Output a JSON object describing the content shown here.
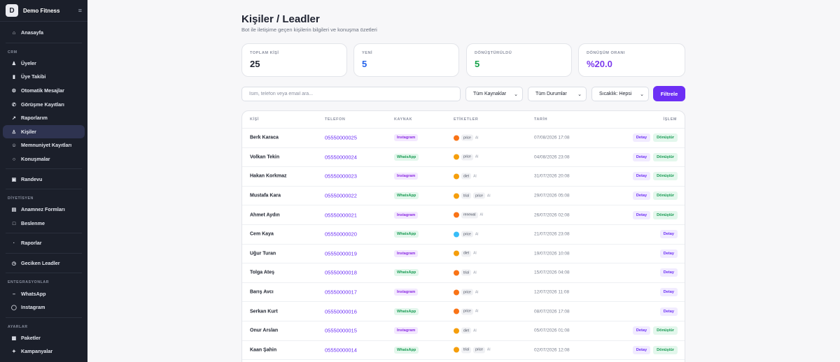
{
  "app": {
    "name": "Demo Fitness",
    "logo_letter": "D"
  },
  "sidebar": {
    "items_top": [
      {
        "label": "Anasayfa",
        "icon": "home-icon"
      }
    ],
    "crm_section": "CRM",
    "crm_items": [
      {
        "label": "Üyeler",
        "icon": "users-icon"
      },
      {
        "label": "Üye Takibi",
        "icon": "bar-chart-icon"
      },
      {
        "label": "Otomatik Mesajlar",
        "icon": "gear-icon"
      },
      {
        "label": "Görüşme Kayıtları",
        "icon": "phone-icon"
      },
      {
        "label": "Raporlarım",
        "icon": "trend-icon"
      },
      {
        "label": "Kişiler",
        "icon": "user-icon",
        "active": true
      },
      {
        "label": "Memnuniyet Kayıtları",
        "icon": "smile-icon"
      },
      {
        "label": "Konuşmalar",
        "icon": "chat-icon"
      }
    ],
    "randevu": {
      "label": "Randevu",
      "icon": "calendar-icon"
    },
    "diyet_section": "DİYETİSYEN",
    "diyet_items": [
      {
        "label": "Anamnez Formları",
        "icon": "document-icon"
      },
      {
        "label": "Beslenme",
        "icon": "message-icon"
      }
    ],
    "raporlar": {
      "label": "Raporlar",
      "icon": "dot-icon"
    },
    "geciken": {
      "label": "Geciken Leadler",
      "icon": "clock-icon"
    },
    "entegrasyon_section": "ENTEGRASYONLAR",
    "entegrasyon_items": [
      {
        "label": "WhatsApp",
        "icon": "dash-icon"
      },
      {
        "label": "Instagram",
        "icon": "instagram-icon"
      }
    ],
    "ayarlar_section": "AYARLAR",
    "ayarlar_items": [
      {
        "label": "Paketler",
        "icon": "package-icon"
      },
      {
        "label": "Kampanyalar",
        "icon": "sparkle-icon"
      }
    ]
  },
  "header": {
    "title": "Kişiler / Leadler",
    "subtitle": "Bot ile iletişime geçen kişilerin bilgileri ve konuşma özetleri"
  },
  "stats": [
    {
      "label": "TOPLAM KİŞİ",
      "value": "25",
      "color": "#1f2430"
    },
    {
      "label": "YENİ",
      "value": "5",
      "color": "#2563eb"
    },
    {
      "label": "DÖNÜŞTÜRÜLDÜ",
      "value": "5",
      "color": "#16a34a"
    },
    {
      "label": "DÖNÜŞÜM ORANI",
      "value": "%20.0",
      "color": "#7c3aed"
    }
  ],
  "filters": {
    "search_placeholder": "İsim, telefon veya email ara...",
    "source": "Tüm Kaynaklar",
    "status": "Tüm Durumlar",
    "temperature": "Sıcaklık: Hepsi",
    "button": "Filtrele"
  },
  "table": {
    "columns": [
      "KİŞİ",
      "TELEFON",
      "KAYNAK",
      "ETİKETLER",
      "TARİH",
      "İŞLEM"
    ],
    "detail_label": "Detay",
    "convert_label": "Dönüştür",
    "rows": [
      {
        "name": "Berk Karaca",
        "phone": "05550000025",
        "source": "Instagram",
        "temp": "hot",
        "tags": [
          "price"
        ],
        "ai": "AI",
        "date": "07/08/2026 17:08",
        "convert": true
      },
      {
        "name": "Volkan Tekin",
        "phone": "05550000024",
        "source": "WhatsApp",
        "temp": "warm",
        "tags": [
          "price"
        ],
        "ai": "AI",
        "date": "04/08/2026 23:08",
        "convert": true
      },
      {
        "name": "Hakan Korkmaz",
        "phone": "05550000023",
        "source": "Instagram",
        "temp": "warm",
        "tags": [
          "diet"
        ],
        "ai": "AI",
        "date": "31/07/2026 20:08",
        "convert": true
      },
      {
        "name": "Mustafa Kara",
        "phone": "05550000022",
        "source": "WhatsApp",
        "temp": "warm",
        "tags": [
          "trial",
          "price"
        ],
        "ai": "AI",
        "date": "29/07/2026 05:08",
        "convert": true
      },
      {
        "name": "Ahmet Aydın",
        "phone": "05550000021",
        "source": "Instagram",
        "temp": "hot",
        "tags": [
          "renewal"
        ],
        "ai": "AI",
        "date": "26/07/2026 02:08",
        "convert": true
      },
      {
        "name": "Cem Kaya",
        "phone": "05550000020",
        "source": "WhatsApp",
        "temp": "cold",
        "tags": [
          "price"
        ],
        "ai": "AI",
        "date": "21/07/2026 23:08",
        "convert": false
      },
      {
        "name": "Uğur Turan",
        "phone": "05550000019",
        "source": "Instagram",
        "temp": "warm",
        "tags": [
          "diet"
        ],
        "ai": "AI",
        "date": "19/07/2026 10:08",
        "convert": false
      },
      {
        "name": "Tolga Ateş",
        "phone": "05550000018",
        "source": "WhatsApp",
        "temp": "hot",
        "tags": [
          "trial"
        ],
        "ai": "AI",
        "date": "15/07/2026 04:08",
        "convert": false
      },
      {
        "name": "Barış Avcı",
        "phone": "05550000017",
        "source": "Instagram",
        "temp": "hot",
        "tags": [
          "price"
        ],
        "ai": "AI",
        "date": "12/07/2026 11:08",
        "convert": false
      },
      {
        "name": "Serkan Kurt",
        "phone": "05550000016",
        "source": "WhatsApp",
        "temp": "hot",
        "tags": [
          "price"
        ],
        "ai": "AI",
        "date": "08/07/2026 17:08",
        "convert": false
      },
      {
        "name": "Onur Arslan",
        "phone": "05550000015",
        "source": "Instagram",
        "temp": "warm",
        "tags": [
          "diet"
        ],
        "ai": "AI",
        "date": "05/07/2026 01:08",
        "convert": true
      },
      {
        "name": "Kaan Şahin",
        "phone": "05550000014",
        "source": "WhatsApp",
        "temp": "warm",
        "tags": [
          "trial",
          "price"
        ],
        "ai": "AI",
        "date": "02/07/2026 12:08",
        "convert": true
      }
    ]
  },
  "colors": {
    "accent": "#6d2ff5",
    "sidebar_bg": "#1b1f2a",
    "hot": "#f97316",
    "warm": "#f59e0b",
    "cold": "#38bdf8"
  }
}
